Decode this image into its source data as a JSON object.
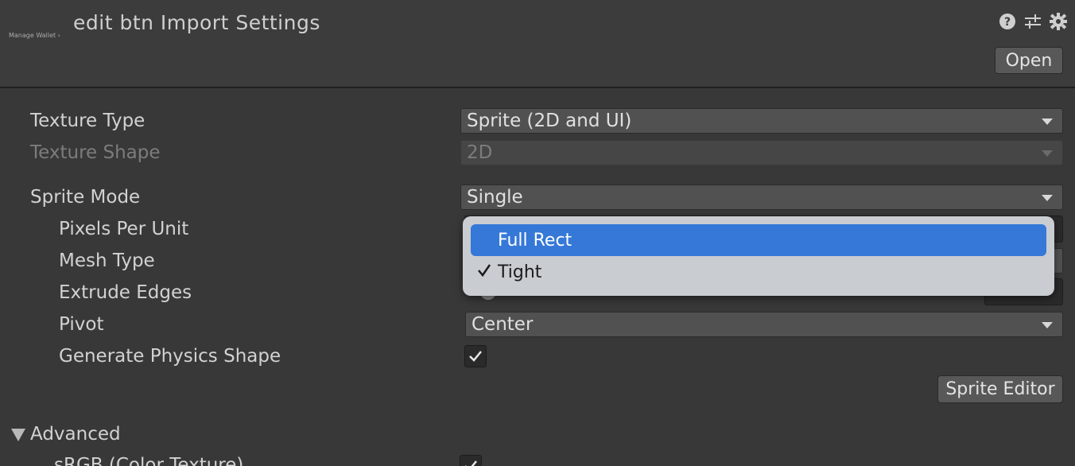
{
  "header": {
    "thumbnail_label": "Manage Wallet ›",
    "title": "edit btn Import Settings",
    "open_label": "Open",
    "icons": [
      "help-icon",
      "presets-icon",
      "gear-icon"
    ]
  },
  "fields": {
    "texture_type": {
      "label": "Texture Type",
      "value": "Sprite (2D and UI)"
    },
    "texture_shape": {
      "label": "Texture Shape",
      "value": "2D"
    },
    "sprite_mode": {
      "label": "Sprite Mode",
      "value": "Single"
    },
    "pixels_per_unit": {
      "label": "Pixels Per Unit"
    },
    "mesh_type": {
      "label": "Mesh Type"
    },
    "extrude_edges": {
      "label": "Extrude Edges"
    },
    "pivot": {
      "label": "Pivot",
      "value": "Center"
    },
    "generate_physics_shape": {
      "label": "Generate Physics Shape",
      "checked": true
    },
    "sprite_editor_label": "Sprite Editor"
  },
  "advanced": {
    "label": "Advanced",
    "srgb_label": "sRGB (Color Texture)"
  },
  "popup": {
    "items": [
      {
        "label": "Full Rect",
        "highlighted": true,
        "checked": false
      },
      {
        "label": "Tight",
        "highlighted": false,
        "checked": true
      }
    ]
  },
  "colors": {
    "highlight": "#3578d8",
    "background": "#383838"
  }
}
